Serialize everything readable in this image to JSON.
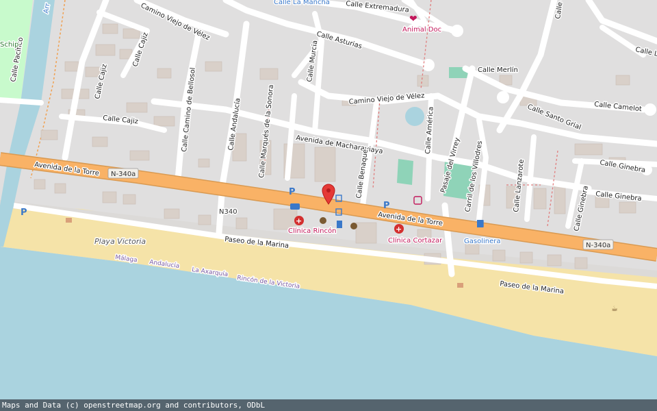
{
  "colors": {
    "land": "#f2efe9",
    "urban": "#e0dfdf",
    "beach": "#f5e3a8",
    "sea": "#aad3df",
    "primary_road": "#f9b266",
    "minor_road": "#ffffff",
    "building": "#d9d0c9",
    "park": "#c8facc",
    "river": "#aad3df",
    "poi_red": "#c2185b",
    "poi_blue": "#3a78c9",
    "marker": "#e53935",
    "attribution_bg": "#46505a"
  },
  "streets": {
    "avenida_torre_1": "Avenida de la Torre",
    "avenida_torre_2": "Avenida de la Torre",
    "n340a_1": "N-340a",
    "n340a_2": "N-340a",
    "n340": "N340",
    "camino_velez_1": "Camino Viejo de Vélez",
    "camino_velez_2": "Camino Viejo de Vélez",
    "calle_extremadura": "Calle Extremadura",
    "calle_asturias": "Calle Asturias",
    "calle_merlin": "Calle Merlín",
    "calle_camelot": "Calle Camelot",
    "calle_santo_grial": "Calle Santo Grial",
    "calle_cajiz_1": "Calle Cajiz",
    "calle_cajiz_2": "Calle Cajiz",
    "calle_cajiz_3": "Calle Cajiz",
    "calle_camino_bellosol": "Calle Camino de Bellosol",
    "calle_andalucia": "Calle Andalucía",
    "calle_marques_sonora": "Calle Marqués de la Sonora",
    "calle_murcia": "Calle Murcia",
    "avenida_macharaviaya": "Avenida de Macharaviaya",
    "calle_benaque": "Calle Benaque",
    "calle_america": "Calle América",
    "pasaje_virrey": "Pasaje del Virrey",
    "carril_villodres": "Carril de los Villodres",
    "calle_lanzarote": "Calle Lanzarote",
    "calle_ginebra_1": "Calle Ginebra",
    "calle_ginebra_2": "Calle Ginebra",
    "calle_ginebra_3": "Calle Ginebra",
    "calle_gua": "Calle Gua",
    "calle_la": "Calle La",
    "calle_pacifico": "Calle Pacífico",
    "paseo_marina_1": "Paseo de la Marina",
    "paseo_marina_2": "Paseo de la Marina"
  },
  "places": {
    "playa_victoria": "Playa Victoria",
    "calle_la_mancha": "Calle La Mancha",
    "schip": "Schip",
    "river_label": "Arr"
  },
  "pois": {
    "animal_doc": "Animal Doc",
    "clinica_rincon": "Clínica Rincón",
    "clinica_cortazar": "Clínica Cortazar",
    "gasolinera": "Gasolinera"
  },
  "boundaries": {
    "malaga": "Málaga",
    "andalucia": "Andalucía",
    "la_axarquia": "La Axarquía",
    "rincon_victoria": "Rincón de la Victoria"
  },
  "icons": {
    "parking": "P",
    "marker": "map-pin-icon",
    "bus": "bus-stop-icon",
    "fuel": "fuel-icon",
    "taxi": "taxi-icon",
    "hospital": "hospital-icon",
    "vet": "veterinary-icon",
    "pharmacy": "pharmacy-icon",
    "cafe": "cafe-icon"
  },
  "attribution": "Maps and Data (c) openstreetmap.org and contributors, ODbL"
}
